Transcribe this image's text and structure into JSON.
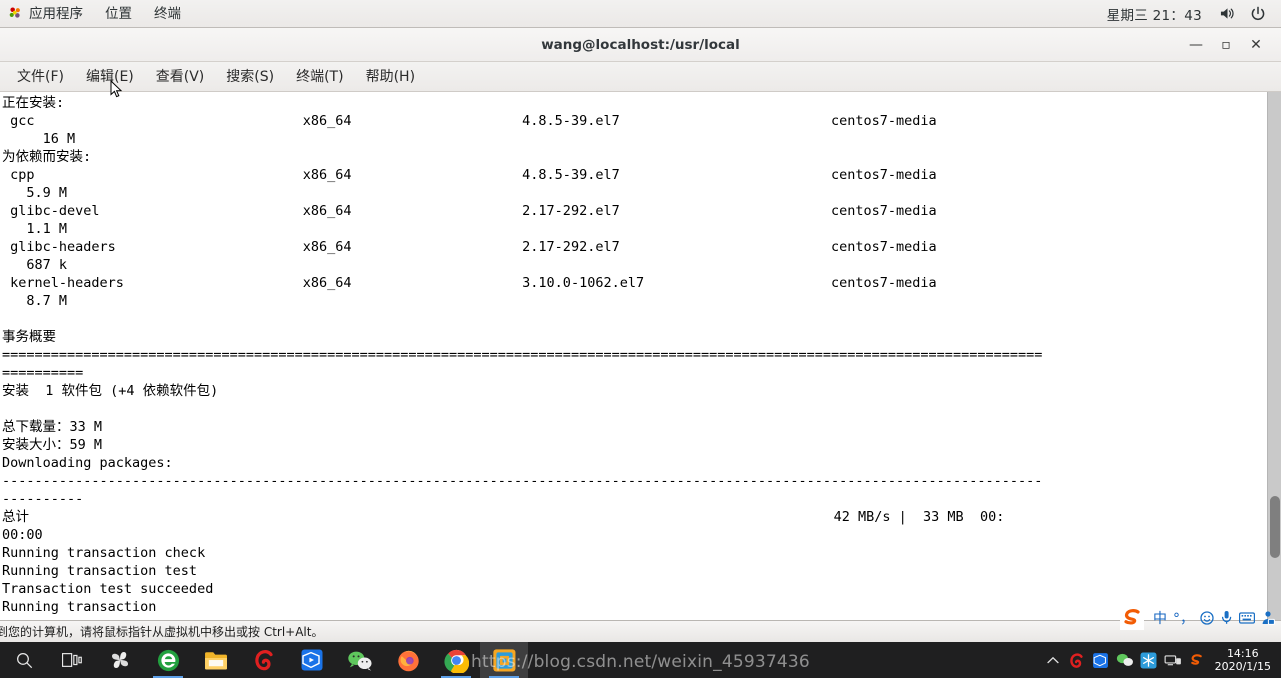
{
  "gnome_panel": {
    "apps_label": "应用程序",
    "places_label": "位置",
    "terminal_label": "终端",
    "clock": "星期三 21：43",
    "volume_icon": "speaker-icon",
    "power_icon": "power-icon"
  },
  "window": {
    "title": "wang@localhost:/usr/local",
    "minimize_label": "—",
    "maximize_label": "▫",
    "close_label": "✕"
  },
  "menubar": {
    "items": [
      {
        "label": "文件(F)"
      },
      {
        "label": "编辑(E)"
      },
      {
        "label": "查看(V)"
      },
      {
        "label": "搜索(S)"
      },
      {
        "label": "终端(T)"
      },
      {
        "label": "帮助(H)"
      }
    ]
  },
  "terminal": {
    "headers": {
      "installing": "正在安装:",
      "installing_deps": "为依赖而安装:",
      "summary": "事务概要"
    },
    "packages": [
      {
        "name": "gcc",
        "arch": "x86_64",
        "version": "4.8.5-39.el7",
        "repo": "centos7-media",
        "size": "16 M"
      },
      {
        "name": "cpp",
        "arch": "x86_64",
        "version": "4.8.5-39.el7",
        "repo": "centos7-media",
        "size": "5.9 M"
      },
      {
        "name": "glibc-devel",
        "arch": "x86_64",
        "version": "2.17-292.el7",
        "repo": "centos7-media",
        "size": "1.1 M"
      },
      {
        "name": "glibc-headers",
        "arch": "x86_64",
        "version": "2.17-292.el7",
        "repo": "centos7-media",
        "size": "687 k"
      },
      {
        "name": "kernel-headers",
        "arch": "x86_64",
        "version": "3.10.0-1062.el7",
        "repo": "centos7-media",
        "size": "8.7 M"
      }
    ],
    "install_line": "安装  1 软件包 (+4 依赖软件包)",
    "total_download": "总下载量：33 M",
    "install_size": "安装大小：59 M",
    "downloading": "Downloading packages:",
    "total_label": "总计",
    "total_rate": "42 MB/s |  33 MB  00:",
    "total_time": "00:00",
    "log_lines": [
      "Running transaction check",
      "Running transaction test",
      "Transaction test succeeded",
      "Running transaction"
    ],
    "screen_text": "正在安装:\n gcc                                 x86_64                     4.8.5-39.el7                          centos7-media\n     16 M\n为依赖而安装:\n cpp                                 x86_64                     4.8.5-39.el7                          centos7-media\n   5.9 M\n glibc-devel                         x86_64                     2.17-292.el7                          centos7-media\n   1.1 M\n glibc-headers                       x86_64                     2.17-292.el7                          centos7-media\n   687 k\n kernel-headers                      x86_64                     3.10.0-1062.el7                       centos7-media\n   8.7 M\n\n事务概要\n================================================================================================================================\n==========\n安装  1 软件包 (+4 依赖软件包)\n\n总下载量：33 M\n安装大小：59 M\nDownloading packages:\n--------------------------------------------------------------------------------------------------------------------------------\n----------\n总计                                                                                                   42 MB/s |  33 MB  00:\n00:00\nRunning transaction check\nRunning transaction test\nTransaction test succeeded\nRunning transaction"
  },
  "vm_status": {
    "message": "到您的计算机，请将鼠标指针从虚拟机中移出或按 Ctrl+Alt。"
  },
  "ime": {
    "logo": "sogou-logo-icon",
    "mode_label": "中",
    "punctuation_label": "°，",
    "emoji_icon": "smiley-icon",
    "mic_icon": "microphone-icon",
    "keyboard_icon": "keyboard-icon",
    "toolbox_icon": "ime-toolbox-icon"
  },
  "taskbar": {
    "icons": [
      {
        "name": "search-icon",
        "active": false
      },
      {
        "name": "task-view-icon",
        "active": false
      },
      {
        "name": "pinwheel-app-icon",
        "active": false
      },
      {
        "name": "ie-browser-icon",
        "active": false,
        "running": true
      },
      {
        "name": "file-explorer-icon",
        "active": false
      },
      {
        "name": "g-app-icon",
        "active": false
      },
      {
        "name": "video-player-icon",
        "active": false
      },
      {
        "name": "wechat-icon",
        "active": false
      },
      {
        "name": "firefox-icon",
        "active": false
      },
      {
        "name": "chrome-icon",
        "active": false,
        "running": true
      },
      {
        "name": "vmware-icon",
        "active": true,
        "running": true
      }
    ],
    "tray": {
      "chevron_icon": "show-hidden-icons-icon",
      "icons": [
        "g-tray-icon",
        "video-tray-icon",
        "wechat-tray-icon",
        "snowflake-tray-icon",
        "network-tray-icon",
        "sogou-tray-icon"
      ],
      "clock_time": "14:16",
      "clock_date": "2020/1/15"
    }
  },
  "watermark": {
    "text": "https://blog.csdn.net/weixin_45937436"
  },
  "colors": {
    "panel_bg": "#f2f1f0",
    "terminal_bg": "#ffffff",
    "terminal_fg": "#000000",
    "taskbar_bg": "#1f1f20",
    "accent": "#5ea0e8"
  }
}
